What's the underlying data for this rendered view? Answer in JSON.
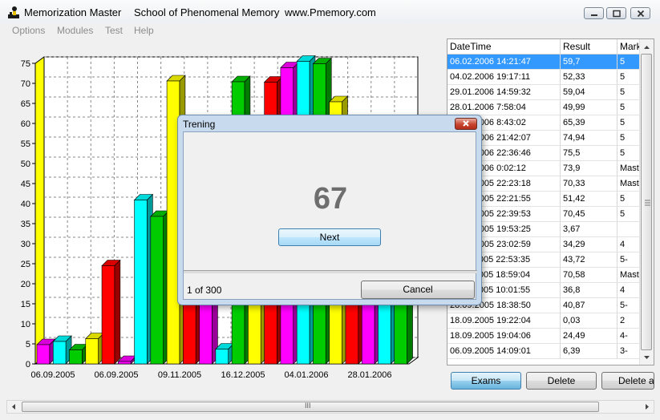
{
  "window": {
    "app_name": "Memorization Master",
    "school": "School of Phenomenal Memory",
    "website": "www.Pmemory.com"
  },
  "menu": [
    "Options",
    "Modules",
    "Test",
    "Help"
  ],
  "chart_data": {
    "type": "bar",
    "style": "3d",
    "ylim": [
      0,
      75
    ],
    "yticks": [
      0,
      5,
      10,
      15,
      20,
      25,
      30,
      35,
      40,
      45,
      50,
      55,
      60,
      65,
      70,
      75
    ],
    "xtick_labels": [
      "06.09.2005",
      "06.09.2005",
      "09.11.2005",
      "16.12.2005",
      "04.01.2006",
      "28.01.2006"
    ],
    "grid": true,
    "bar_colors_cycle": [
      "#ff00ff",
      "#00ffff",
      "#00cc00",
      "#ffff00",
      "#ff0000"
    ],
    "values": [
      4.8,
      5.6,
      3.5,
      6.3,
      24.5,
      0.6,
      40.9,
      36.8,
      70.6,
      43.7,
      34.3,
      3.7,
      70.4,
      51.4,
      70.3,
      73.9,
      75.5,
      74.9,
      65.4,
      50.0,
      59.0,
      52.3,
      59.7
    ]
  },
  "table": {
    "columns": [
      "DateTime",
      "Result",
      "Mark"
    ],
    "rows": [
      [
        "06.02.2006 14:21:47",
        "59,7",
        "5"
      ],
      [
        "04.02.2006 19:17:11",
        "52,33",
        "5"
      ],
      [
        "29.01.2006 14:59:32",
        "59,04",
        "5"
      ],
      [
        "28.01.2006 7:58:04",
        "49,99",
        "5"
      ],
      [
        "27.01.2006 8:43:02",
        "65,39",
        "5"
      ],
      [
        "25.01.2006 21:42:07",
        "74,94",
        "5"
      ],
      [
        "21.01.2006 22:36:46",
        "75,5",
        "5"
      ],
      [
        "17.01.2006 0:02:12",
        "73,9",
        "Master"
      ],
      [
        "02.01.2005 22:23:18",
        "70,33",
        "Master"
      ],
      [
        "22.12.2005 22:21:55",
        "51,42",
        "5"
      ],
      [
        "16.12.2005 22:39:53",
        "70,45",
        "5"
      ],
      [
        "14.12.2005 19:53:25",
        "3,67",
        ""
      ],
      [
        "10.12.2005 23:02:59",
        "34,29",
        "4"
      ],
      [
        "29.11.2005 22:53:35",
        "43,72",
        "5-"
      ],
      [
        "20.11.2005 18:59:04",
        "70,58",
        "Master"
      ],
      [
        "15.11.2005 10:01:55",
        "36,8",
        "4"
      ],
      [
        "28.09.2005 18:38:50",
        "40,87",
        "5-"
      ],
      [
        "18.09.2005 19:22:04",
        "0,03",
        "2"
      ],
      [
        "18.09.2005 19:04:06",
        "24,49",
        "4-"
      ],
      [
        "06.09.2005 14:09:01",
        "6,39",
        "3-"
      ]
    ],
    "selected_row": 0
  },
  "buttons": {
    "exams": "Exams",
    "delete": "Delete",
    "delete_all": "Delete all"
  },
  "dialog": {
    "title": "Trening",
    "number": "67",
    "next": "Next",
    "counter": "1 of 300",
    "cancel": "Cancel"
  },
  "hscroll_grip": "III",
  "colors": {
    "selection": "#3399ff",
    "axis_number_color": "#6e6e6e"
  }
}
